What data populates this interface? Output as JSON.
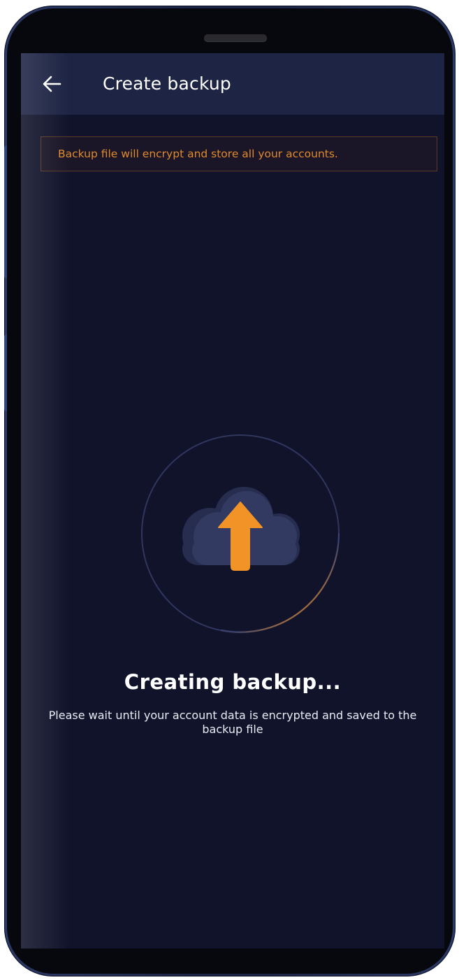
{
  "app": {
    "title": "Create backup"
  },
  "banner": {
    "text": "Backup file will encrypt and store all your accounts."
  },
  "status": {
    "title": "Creating backup...",
    "description": "Please wait until your account data is encrypted and saved to the backup file"
  },
  "icons": {
    "back": "arrow-left-icon",
    "cloud": "cloud-upload-icon"
  },
  "colors": {
    "background": "#10132a",
    "appbar": "#1d2444",
    "accent": "#f29327",
    "banner_text": "#e08a2c"
  }
}
